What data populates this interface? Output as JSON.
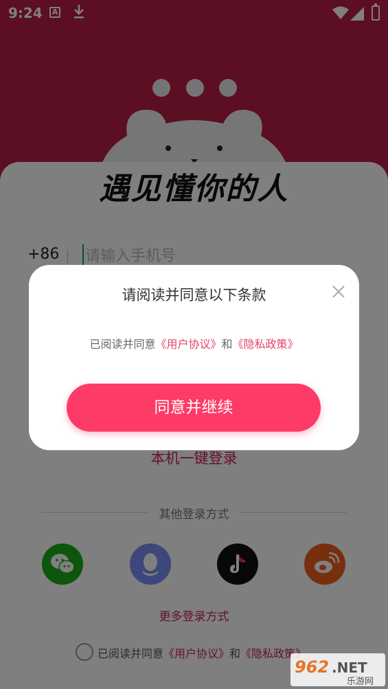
{
  "status_bar": {
    "time": "9:24",
    "icons": [
      "keyboard-a-icon",
      "download-icon",
      "wifi-icon",
      "signal-icon",
      "battery-icon"
    ]
  },
  "hero": {
    "slogan": "遇见懂你的人",
    "background_color": "#b81d47"
  },
  "login": {
    "country_code": "+86",
    "phone_placeholder": "请输入手机号",
    "phone_value": "",
    "onekey_label": "本机一键登录",
    "other_methods_label": "其他登录方式",
    "social_icons": [
      "wechat-icon",
      "qq-icon",
      "tiktok-icon",
      "weibo-icon"
    ],
    "more_methods_label": "更多登录方式",
    "agreement": {
      "prefix": "已阅读并同意",
      "user_agreement": "《用户协议》",
      "and": "和",
      "privacy_policy": "《隐私政策》",
      "checked": false
    }
  },
  "dialog": {
    "title": "请阅读并同意以下条款",
    "message_prefix": "已阅读并同意",
    "user_agreement": "《用户协议》",
    "and": "和",
    "privacy_policy": "《隐私政策》",
    "confirm_label": "同意并继续",
    "accent_color": "#fe3a66"
  },
  "watermark": {
    "text": "962.NET",
    "subtext": "乐游网"
  }
}
